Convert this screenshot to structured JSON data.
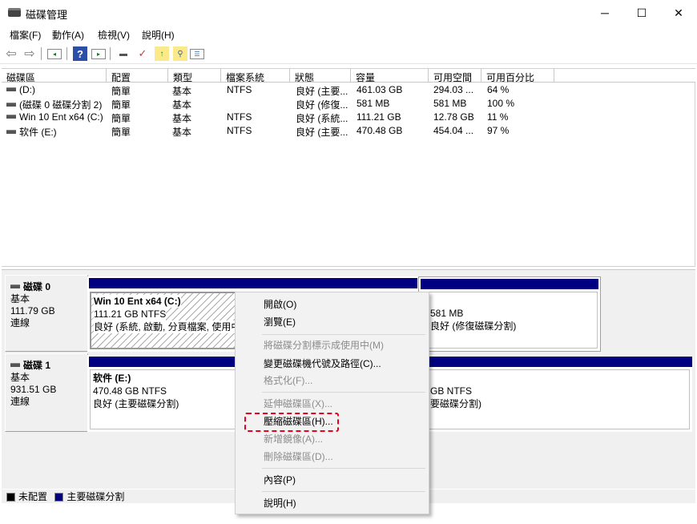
{
  "window": {
    "title": "磁碟管理",
    "minimize": "─",
    "maximize": "☐",
    "close": "✕"
  },
  "menu": [
    "檔案(F)",
    "動作(A)",
    "檢視(V)",
    "說明(H)"
  ],
  "toolbar": [
    "back-icon",
    "forward-icon",
    "console-tree-icon",
    "help-icon",
    "action-pane-icon",
    "connect-disk-icon",
    "check-icon",
    "folder-up-icon",
    "folder-search-icon",
    "properties-list-icon"
  ],
  "table": {
    "columns": [
      "磁碟區",
      "配置",
      "類型",
      "檔案系統",
      "狀態",
      "容量",
      "可用空間",
      "可用百分比"
    ],
    "rows": [
      [
        "(D:)",
        "簡單",
        "基本",
        "NTFS",
        "良好 (主要...",
        "461.03 GB",
        "294.03 ...",
        "64 %"
      ],
      [
        "(磁碟 0 磁碟分割 2)",
        "簡單",
        "基本",
        "",
        "良好 (修復...",
        "581 MB",
        "581 MB",
        "100 %"
      ],
      [
        "Win 10 Ent x64 (C:)",
        "簡單",
        "基本",
        "NTFS",
        "良好 (系統...",
        "111.21 GB",
        "12.78 GB",
        "11 %"
      ],
      [
        "软件 (E:)",
        "簡單",
        "基本",
        "NTFS",
        "良好 (主要...",
        "470.48 GB",
        "454.04 ...",
        "97 %"
      ]
    ]
  },
  "disks": [
    {
      "name": "磁碟 0",
      "type": "基本",
      "size": "111.79 GB",
      "status": "連線",
      "partitions": [
        {
          "name": "Win 10 Ent x64  (C:)",
          "size": "111.21 GB NTFS",
          "status": "良好 (系統, 啟動, 分頁檔案, 使用中"
        },
        {
          "name": "",
          "size": "581 MB",
          "status": "良好 (修復磁碟分割)"
        }
      ]
    },
    {
      "name": "磁碟 1",
      "type": "基本",
      "size": "931.51 GB",
      "status": "連線",
      "partitions": [
        {
          "name": "软件  (E:)",
          "size": "470.48 GB NTFS",
          "status": "良好 (主要磁碟分割)"
        },
        {
          "name": "",
          "size": "GB NTFS",
          "status": "要磁碟分割)"
        }
      ]
    }
  ],
  "legend": [
    {
      "label": "未配置",
      "color": "#000000"
    },
    {
      "label": "主要磁碟分割",
      "color": "#000080"
    }
  ],
  "context_menu": [
    {
      "label": "開啟(O)",
      "enabled": true
    },
    {
      "label": "瀏覽(E)",
      "enabled": true
    },
    {
      "label": "將磁碟分割標示成使用中(M)",
      "enabled": false
    },
    {
      "label": "變更磁碟機代號及路徑(C)...",
      "enabled": true
    },
    {
      "label": "格式化(F)...",
      "enabled": false
    },
    {
      "label": "延伸磁碟區(X)...",
      "enabled": false
    },
    {
      "label": "壓縮磁碟區(H)...",
      "enabled": true,
      "highlighted": true
    },
    {
      "label": "新增鏡像(A)...",
      "enabled": false
    },
    {
      "label": "刪除磁碟區(D)...",
      "enabled": false
    },
    {
      "label": "內容(P)",
      "enabled": true
    },
    {
      "label": "說明(H)",
      "enabled": true
    }
  ],
  "colors": {
    "partition_bar": "#000080",
    "highlight": "#e8001c"
  }
}
